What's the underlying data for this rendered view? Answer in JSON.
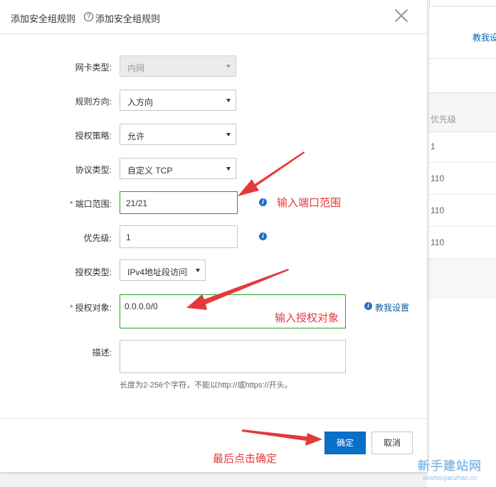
{
  "background": {
    "link": "教我设",
    "column_header": "优先级",
    "rows": [
      "1",
      "110",
      "110",
      "110"
    ]
  },
  "dialog": {
    "title": "添加安全组规则",
    "subtitle": "添加安全组规则",
    "help_icon_glyph": "?",
    "fields": {
      "nic_type": {
        "label": "网卡类型:",
        "value": "内网",
        "disabled": true
      },
      "direction": {
        "label": "规则方向:",
        "value": "入方向"
      },
      "policy": {
        "label": "授权策略:",
        "value": "允许"
      },
      "protocol": {
        "label": "协议类型:",
        "value": "自定义 TCP"
      },
      "port_range": {
        "label": "端口范围:",
        "value": "21/21",
        "required": true
      },
      "priority": {
        "label": "优先级:",
        "value": "1"
      },
      "auth_type": {
        "label": "授权类型:",
        "value": "IPv4地址段访问"
      },
      "auth_object": {
        "label": "授权对象:",
        "value": "0.0.0.0/0",
        "required": true
      },
      "description": {
        "label": "描述:",
        "value": ""
      }
    },
    "required_mark": "*",
    "teach_link": "教我设置",
    "info_glyph": "i",
    "description_hint": "长度为2-256个字符，不能以http://或https://开头。",
    "confirm_label": "确定",
    "cancel_label": "取消"
  },
  "annotations": {
    "port": "输入端口范围",
    "auth": "输入授权对象",
    "confirm": "最后点击确定"
  },
  "watermark": {
    "line1": "新手建站网",
    "line2": "xinshoujianzhan.cn"
  },
  "colors": {
    "primary": "#0a6fc9",
    "annotation_red": "#e4393c",
    "valid_green": "#23a323",
    "link_blue": "#0b5ea8"
  }
}
